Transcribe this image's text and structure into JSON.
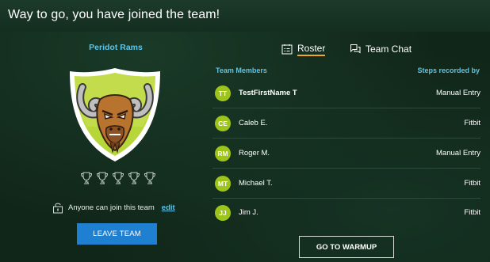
{
  "header": {
    "title": "Way to go, you have joined the team!"
  },
  "team": {
    "name": "Peridot Rams",
    "logo_icon": "ram-shield-icon",
    "trophy_icon": "trophy-outline-icon",
    "trophy_count": 5,
    "join_text": "Anyone can join this team",
    "edit_label": "edit",
    "leave_label": "LEAVE TEAM"
  },
  "tabs": [
    {
      "label": "Roster",
      "icon": "roster-icon",
      "active": true
    },
    {
      "label": "Team Chat",
      "icon": "chat-icon",
      "active": false
    }
  ],
  "roster": {
    "col_members": "Team Members",
    "col_steps": "Steps recorded by",
    "members": [
      {
        "initials": "TT",
        "name": "TestFirstName T",
        "source": "Manual Entry",
        "bold": true
      },
      {
        "initials": "CE",
        "name": "Caleb E.",
        "source": "Fitbit",
        "bold": false
      },
      {
        "initials": "RM",
        "name": "Roger M.",
        "source": "Manual Entry",
        "bold": false
      },
      {
        "initials": "MT",
        "name": "Michael T.",
        "source": "Fitbit",
        "bold": false
      },
      {
        "initials": "JJ",
        "name": "Jim J.",
        "source": "Fitbit",
        "bold": false
      }
    ]
  },
  "footer": {
    "warmup_label": "GO TO WARMUP"
  },
  "colors": {
    "accent_blue": "#5dc4e6",
    "button_blue": "#1f7fd1",
    "avatar_green": "#9cc41a",
    "tab_underline": "#f5a623"
  }
}
